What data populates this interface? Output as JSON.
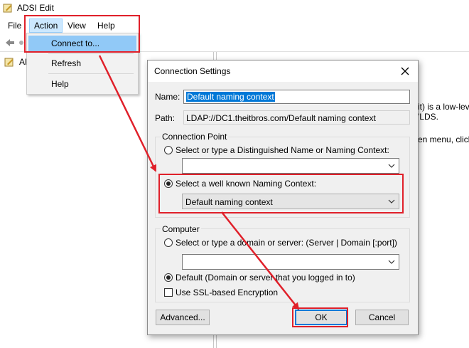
{
  "window": {
    "title": "ADSI Edit",
    "app_icon": "adsi-edit-icon"
  },
  "menubar": {
    "file": "File",
    "action": "Action",
    "view": "View",
    "help": "Help"
  },
  "toolbar": {
    "back_icon": "back-arrow-icon"
  },
  "tree": {
    "root_label": "Al"
  },
  "right_pane": {
    "line1": "it) is a low-lev",
    "line2": "'LDS.",
    "line3": "en menu, click"
  },
  "action_menu": {
    "connect": "Connect to...",
    "refresh": "Refresh",
    "help": "Help"
  },
  "dialog": {
    "title": "Connection Settings",
    "name_label": "Name:",
    "name_value": "Default naming context",
    "path_label": "Path:",
    "path_value": "LDAP://DC1.theitbros.com/Default naming context",
    "connection_point": {
      "legend": "Connection Point",
      "option_dn": "Select or type a Distinguished Name or Naming Context:",
      "dn_value": "",
      "option_known": "Select a well known Naming Context:",
      "known_value": "Default naming context",
      "selected": "known"
    },
    "computer": {
      "legend": "Computer",
      "option_server": "Select or type a domain or server: (Server | Domain [:port])",
      "server_value": "",
      "option_default": "Default (Domain or server that you logged in to)",
      "ssl_label": "Use SSL-based Encryption",
      "ssl_checked": false,
      "selected": "default"
    },
    "advanced_button": "Advanced...",
    "ok_button": "OK",
    "cancel_button": "Cancel"
  },
  "colors": {
    "highlight_red": "#e0202a",
    "menu_selected": "#91c9f7",
    "accent": "#0078d7"
  }
}
